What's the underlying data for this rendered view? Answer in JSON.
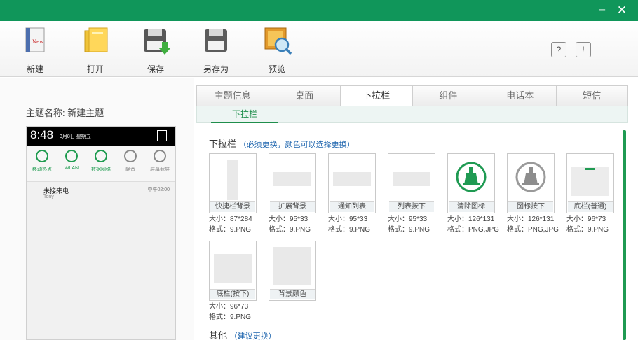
{
  "window": {
    "minimize": "−",
    "close": "✕"
  },
  "toolbar": {
    "items": [
      {
        "label": "新建",
        "icon": "new-file-icon"
      },
      {
        "label": "打开",
        "icon": "open-folder-icon"
      },
      {
        "label": "保存",
        "icon": "save-disk-icon"
      },
      {
        "label": "另存为",
        "icon": "save-as-disk-icon"
      },
      {
        "label": "预览",
        "icon": "preview-magnifier-icon"
      }
    ],
    "help": "?",
    "feedback": "!"
  },
  "left": {
    "theme_name_label": "主题名称: 新建主题",
    "status": {
      "time": "8:48",
      "date": "3月8日 星期五"
    },
    "quick_settings": [
      {
        "label": "移动热点"
      },
      {
        "label": "WLAN"
      },
      {
        "label": "数据网络"
      },
      {
        "label": "静音"
      },
      {
        "label": "屏幕截屏"
      }
    ],
    "notification": {
      "title": "未接来电",
      "sub": "Tony",
      "time": "中午02:00"
    }
  },
  "tabs": [
    "主题信息",
    "桌面",
    "下拉栏",
    "组件",
    "电话本",
    "短信"
  ],
  "subtab": "下拉栏",
  "section1": {
    "title": "下拉栏",
    "note": "（必须更换，颜色可以选择更换）"
  },
  "cards": [
    {
      "caption": "快捷栏背景",
      "size": "大小：87*284",
      "format": "格式：9.PNG"
    },
    {
      "caption": "扩展背景",
      "size": "大小：95*33",
      "format": "格式：9.PNG"
    },
    {
      "caption": "通知列表",
      "size": "大小：95*33",
      "format": "格式：9.PNG"
    },
    {
      "caption": "列表按下",
      "size": "大小：95*33",
      "format": "格式：9.PNG"
    },
    {
      "caption": "清除图标",
      "size": "大小：126*131",
      "format": "格式：PNG,JPG"
    },
    {
      "caption": "图标按下",
      "size": "大小：126*131",
      "format": "格式：PNG,JPG"
    },
    {
      "caption": "底栏(普通)",
      "size": "大小：96*73",
      "format": "格式：9.PNG"
    },
    {
      "caption": "底栏(按下)",
      "size": "大小：96*73",
      "format": "格式：9.PNG"
    },
    {
      "caption": "背景颜色",
      "size": "",
      "format": ""
    }
  ],
  "section2": {
    "title": "其他",
    "note": "（建议更换）"
  },
  "colors": {
    "accent": "#10965a",
    "link": "#1b63ad"
  }
}
